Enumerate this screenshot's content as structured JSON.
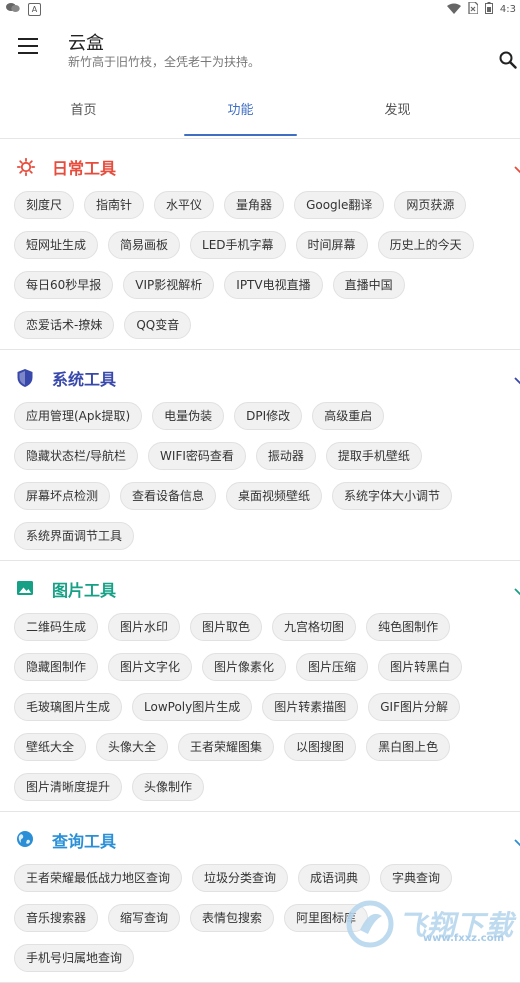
{
  "status": {
    "time": "4:3",
    "letter_icon_label": "A",
    "battery": ""
  },
  "app": {
    "title": "云盒",
    "subtitle": "新竹高于旧竹枝，全凭老干为扶持。"
  },
  "tabs": [
    {
      "label": "首页",
      "active": false
    },
    {
      "label": "功能",
      "active": true
    },
    {
      "label": "发现",
      "active": false
    }
  ],
  "sections": [
    {
      "title": "日常工具",
      "color": "#e74c3c",
      "icon": "sun-icon",
      "items": [
        "刻度尺",
        "指南针",
        "水平仪",
        "量角器",
        "Google翻译",
        "网页获源",
        "短网址生成",
        "简易画板",
        "LED手机字幕",
        "时间屏幕",
        "历史上的今天",
        "每日60秒早报",
        "VIP影视解析",
        "IPTV电视直播",
        "直播中国",
        "恋爱话术-撩妹",
        "QQ变音"
      ]
    },
    {
      "title": "系统工具",
      "color": "#3949ab",
      "icon": "shield-icon",
      "items": [
        "应用管理(Apk提取)",
        "电量伪装",
        "DPI修改",
        "高级重启",
        "隐藏状态栏/导航栏",
        "WIFI密码查看",
        "振动器",
        "提取手机壁纸",
        "屏幕坏点检测",
        "查看设备信息",
        "桌面视频壁纸",
        "系统字体大小调节",
        "系统界面调节工具"
      ]
    },
    {
      "title": "图片工具",
      "color": "#16a085",
      "icon": "image-icon",
      "items": [
        "二维码生成",
        "图片水印",
        "图片取色",
        "九宫格切图",
        "纯色图制作",
        "隐藏图制作",
        "图片文字化",
        "图片像素化",
        "图片压缩",
        "图片转黑白",
        "毛玻璃图片生成",
        "LowPoly图片生成",
        "图片转素描图",
        "GIF图片分解",
        "壁纸大全",
        "头像大全",
        "王者荣耀图集",
        "以图搜图",
        "黑白图上色",
        "图片清晰度提升",
        "头像制作"
      ]
    },
    {
      "title": "查询工具",
      "color": "#2a8fd6",
      "icon": "globe-icon",
      "items": [
        "王者荣耀最低战力地区查询",
        "垃圾分类查询",
        "成语词典",
        "字典查询",
        "音乐搜索器",
        "缩写查询",
        "表情包搜索",
        "阿里图标库",
        "",
        "手机号归属地查询"
      ]
    }
  ],
  "watermark": {
    "text": "飞翔下载",
    "sub": "www.fxxz.com"
  }
}
